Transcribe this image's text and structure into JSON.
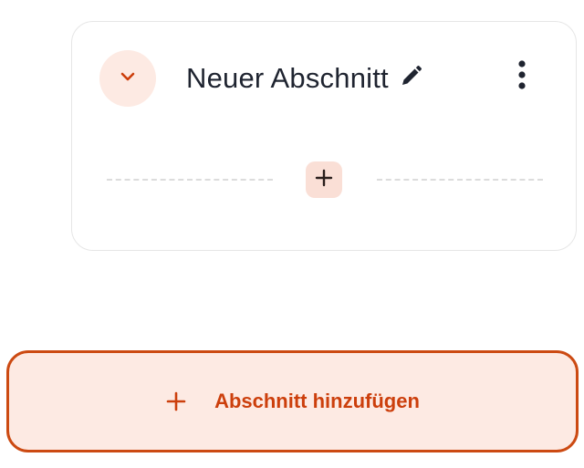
{
  "section": {
    "title": "Neuer Abschnitt"
  },
  "actions": {
    "add_section_label": "Abschnitt hinzufügen"
  },
  "icons": {
    "collapse": "chevron-down-icon",
    "edit": "pencil-icon",
    "more": "more-vertical-icon",
    "add_inline": "plus-icon",
    "add_section": "plus-icon"
  },
  "colors": {
    "accent": "#cc4a12",
    "accent_text": "#cc3f0c",
    "accent_soft": "#fdeae3",
    "text": "#1f2430"
  }
}
